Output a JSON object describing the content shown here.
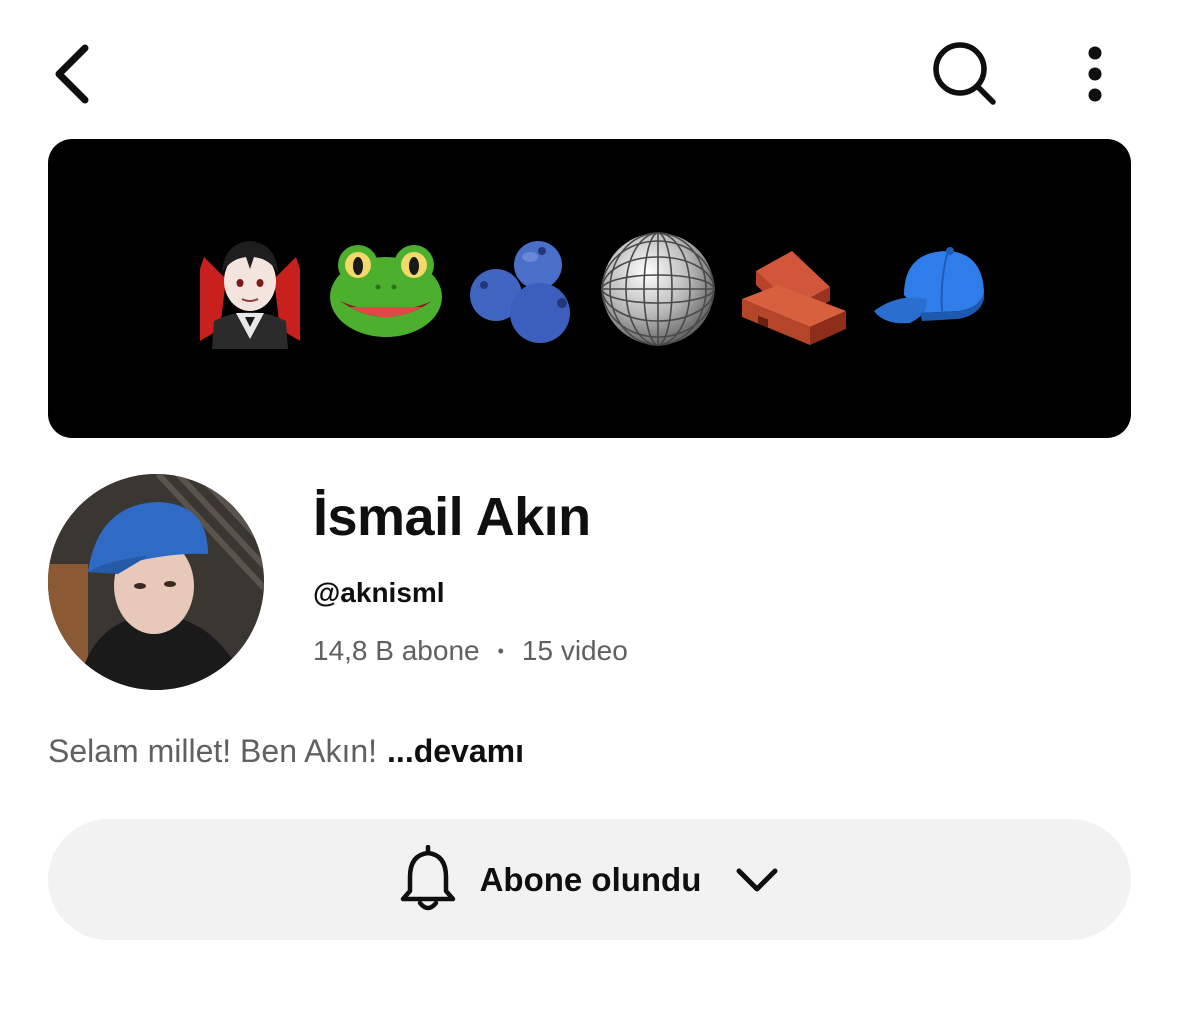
{
  "header": {
    "back_icon": "chevron-left-icon",
    "search_icon": "search-icon",
    "more_icon": "more-vertical-icon"
  },
  "banner": {
    "background": "#000000",
    "emojis": [
      "vampire",
      "frog",
      "blueberries",
      "mirror-ball",
      "bricks",
      "baseball-cap"
    ]
  },
  "channel": {
    "name": "İsmail Akın",
    "handle": "@aknisml",
    "subscribers": "14,8 B abone",
    "separator": "•",
    "videos": "15 video",
    "description": "Selam millet! Ben Akın!",
    "description_more": "...devamı"
  },
  "subscribe": {
    "label": "Abone olundu",
    "bell_icon": "bell-icon",
    "dropdown_icon": "chevron-down-icon",
    "background": "#f2f2f2"
  }
}
